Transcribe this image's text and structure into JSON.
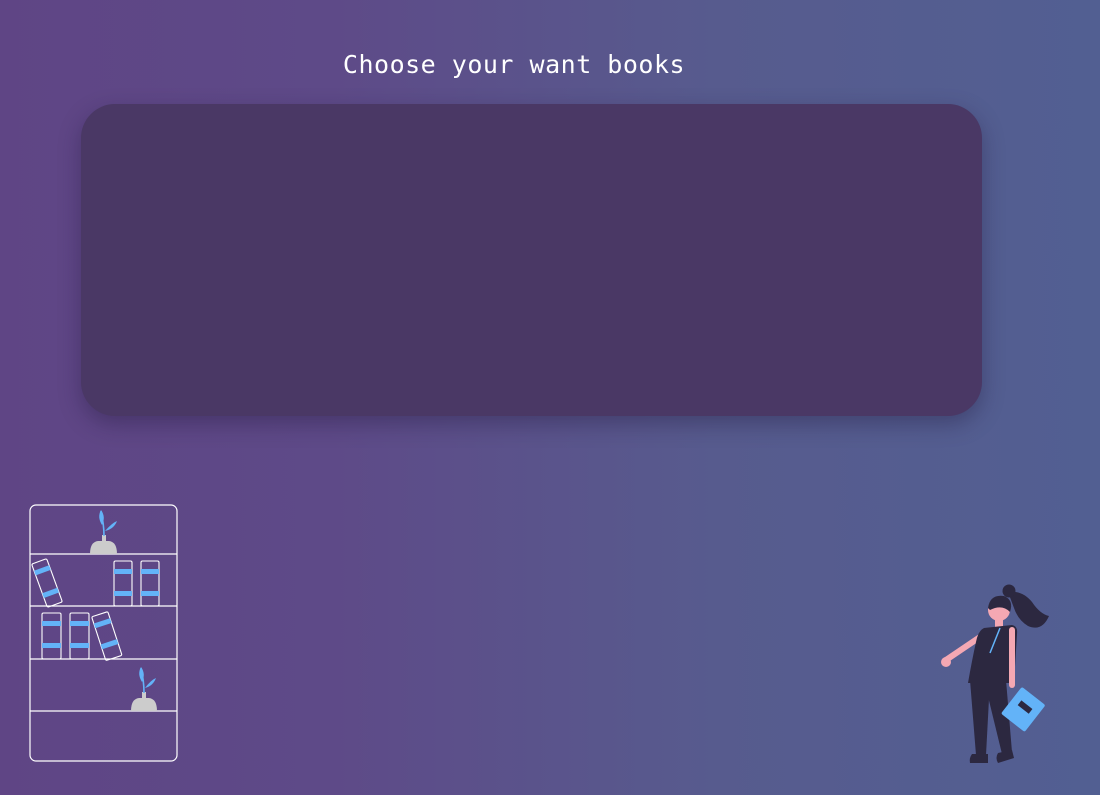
{
  "header": {
    "title": "Choose your want books"
  },
  "book_panel": {
    "items": []
  },
  "illustrations": {
    "left": "bookshelf-illustration",
    "right": "reader-with-book-illustration"
  },
  "colors": {
    "background_start": "#5f4585",
    "background_end": "#525f92",
    "panel": "#4a3865",
    "accent": "#63b3f8",
    "outline": "#ffffff",
    "skin": "#f4a8b3",
    "clothing": "#2c2840",
    "pot": "#cccccc"
  }
}
